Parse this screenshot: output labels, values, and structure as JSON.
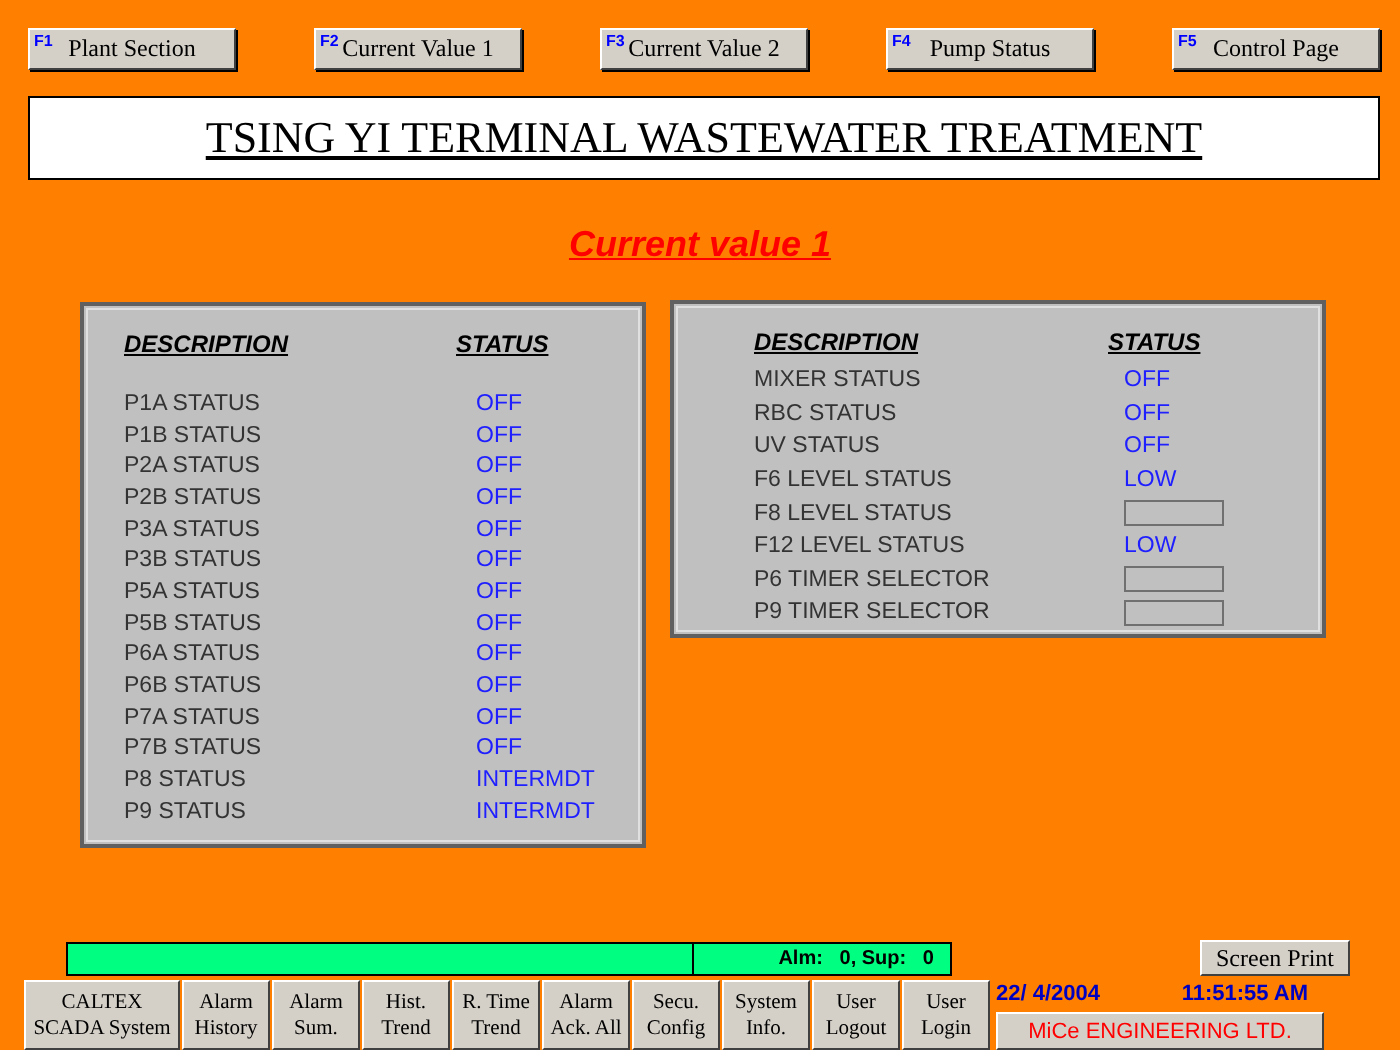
{
  "function_keys": [
    {
      "key": "F1",
      "label": "Plant Section"
    },
    {
      "key": "F2",
      "label": "Current Value 1"
    },
    {
      "key": "F3",
      "label": "Current Value 2"
    },
    {
      "key": "F4",
      "label": "Pump Status"
    },
    {
      "key": "F5",
      "label": "Control Page"
    }
  ],
  "title": "TSING YI TERMINAL WASTEWATER TREATMENT",
  "subtitle": "Current value 1",
  "panels": [
    {
      "headers": [
        "DESCRIPTION",
        "STATUS"
      ],
      "rows": [
        {
          "label": "P1A STATUS",
          "kind": "text",
          "status": "OFF"
        },
        {
          "label": "P1B STATUS",
          "kind": "text",
          "status": "OFF"
        },
        {
          "label": "P2A STATUS",
          "kind": "text",
          "status": "OFF"
        },
        {
          "label": "P2B STATUS",
          "kind": "text",
          "status": "OFF"
        },
        {
          "label": "P3A STATUS",
          "kind": "text",
          "status": "OFF"
        },
        {
          "label": "P3B STATUS",
          "kind": "text",
          "status": "OFF"
        },
        {
          "label": "P5A STATUS",
          "kind": "text",
          "status": "OFF"
        },
        {
          "label": "P5B STATUS",
          "kind": "text",
          "status": "OFF"
        },
        {
          "label": "P6A STATUS",
          "kind": "text",
          "status": "OFF"
        },
        {
          "label": "P6B STATUS",
          "kind": "text",
          "status": "OFF"
        },
        {
          "label": "P7A STATUS",
          "kind": "text",
          "status": "OFF"
        },
        {
          "label": "P7B STATUS",
          "kind": "text",
          "status": "OFF"
        },
        {
          "label": "P8 STATUS",
          "kind": "text",
          "status": "INTERMDT"
        },
        {
          "label": "P9 STATUS",
          "kind": "text",
          "status": "INTERMDT"
        }
      ]
    },
    {
      "headers": [
        "DESCRIPTION",
        "STATUS"
      ],
      "rows": [
        {
          "label": "MIXER STATUS",
          "kind": "text",
          "status": "OFF"
        },
        {
          "label": "RBC STATUS",
          "kind": "text",
          "status": "OFF"
        },
        {
          "label": "UV STATUS",
          "kind": "text",
          "status": "OFF"
        },
        {
          "label": "F6 LEVEL STATUS",
          "kind": "text",
          "status": "LOW"
        },
        {
          "label": "F8 LEVEL STATUS",
          "kind": "empty"
        },
        {
          "label": "F12 LEVEL STATUS",
          "kind": "text",
          "status": "LOW"
        },
        {
          "label": "P6 TIMER SELECTOR",
          "kind": "empty"
        },
        {
          "label": "P9 TIMER SELECTOR",
          "kind": "empty"
        }
      ]
    }
  ],
  "alarm_bar": {
    "summary": "Alm:   0, Sup:   0"
  },
  "screen_print": "Screen Print",
  "nav_buttons": [
    {
      "lines": [
        "CALTEX",
        "SCADA System"
      ]
    },
    {
      "lines": [
        "Alarm",
        "History"
      ]
    },
    {
      "lines": [
        "Alarm",
        "Sum."
      ]
    },
    {
      "lines": [
        "Hist.",
        "Trend"
      ]
    },
    {
      "lines": [
        "R. Time",
        "Trend"
      ]
    },
    {
      "lines": [
        "Alarm",
        "Ack. All"
      ]
    },
    {
      "lines": [
        "Secu.",
        "Config"
      ]
    },
    {
      "lines": [
        "System",
        "Info."
      ]
    },
    {
      "lines": [
        "User",
        "Logout"
      ]
    },
    {
      "lines": [
        "User",
        "Login"
      ]
    }
  ],
  "date": "22/ 4/2004",
  "time": "11:51:55 AM",
  "company": "MiCe ENGINEERING LTD."
}
